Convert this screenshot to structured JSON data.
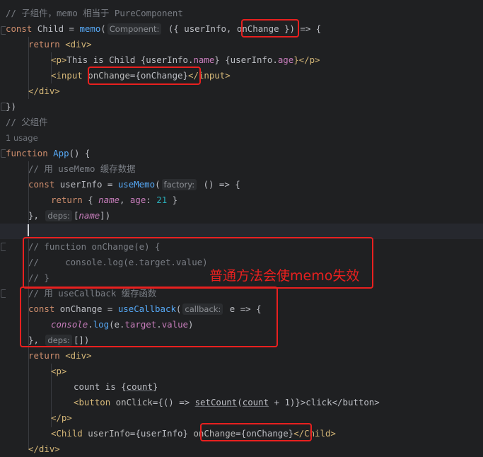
{
  "code": {
    "l1": "// 子组件，memo 相当于 PureComponent",
    "l2_kw": "const",
    "l2_name": " Child = ",
    "l2_fn": "memo",
    "l2_open": "(",
    "l2_hint": "Component:",
    "l2_rest": " ({ userInfo,",
    "l2_on": "onChange",
    "l2_end": " }) => {",
    "l3_kw": "return",
    "l3_tag": " <div>",
    "l4_open": "<p>",
    "l4_text": "This is Child {userInfo.",
    "l4_p1": "name",
    "l4_mid": "} {userInfo.",
    "l4_p2": "age",
    "l4_close": "}</p>",
    "l5_tag": "<input",
    "l5_attr": "onChange",
    "l5_val": "={onChange}",
    "l5_close": "</input>",
    "l6": "</div>",
    "l7": "})",
    "l8": "// 父组件",
    "l9": "1 usage",
    "l10_kw": "function",
    "l10_fn": "App",
    "l10_rest": "() {",
    "l11": "// 用 useMemo 缓存数据",
    "l12_kw": "const",
    "l12_name": " userInfo = ",
    "l12_fn": "useMemo",
    "l12_hint": "factory:",
    "l12_rest": " () => {",
    "l13_kw": "return",
    "l13_a": " { ",
    "l13_name": "name",
    "l13_b": ", ",
    "l13_age": "age",
    "l13_c": ": ",
    "l13_num": "21",
    "l13_d": " }",
    "l14_a": "},",
    "l14_hint": "deps:",
    "l14_b": "[",
    "l14_name": "name",
    "l14_c": "])",
    "l16": "// function onChange(e) {",
    "l17": "//     console.log(e.target.value)",
    "l18": "// }",
    "l19": "// 用 useCallback 缓存函数",
    "l20_kw": "const",
    "l20_name": " onChange = ",
    "l20_fn": "useCallback",
    "l20_hint": "callback:",
    "l20_rest": " e => {",
    "l21_obj": "console",
    "l21_dot": ".",
    "l21_fn": "log",
    "l21_rest": "(e.",
    "l21_p1": "target",
    "l21_dot2": ".",
    "l21_p2": "value",
    "l21_end": ")",
    "l22_a": "},",
    "l22_hint": "deps:",
    "l22_b": "[])",
    "l23_kw": "return",
    "l23_tag": " <div>",
    "l24": "<p>",
    "l25_a": "count is {",
    "l25_b": "count",
    "l25_c": "}",
    "l26_tag": "<button",
    "l26_attr": " onClick",
    "l26_a": "={() => ",
    "l26_fn": "setCount",
    "l26_b": "(",
    "l26_c": "count",
    "l26_d": " + 1)}>click</button>",
    "l27": "</p>",
    "l28_tag": "<Child",
    "l28_attr": " userInfo",
    "l28_a": "={userInfo}",
    "l28_attr2": "onChange",
    "l28_b": "={onChange}",
    "l28_close": "</Child>",
    "l29": "</div>"
  },
  "annotation": "普通方法会使memo失效",
  "colors": {
    "highlight": "#e8201f",
    "background": "#1f2022"
  }
}
